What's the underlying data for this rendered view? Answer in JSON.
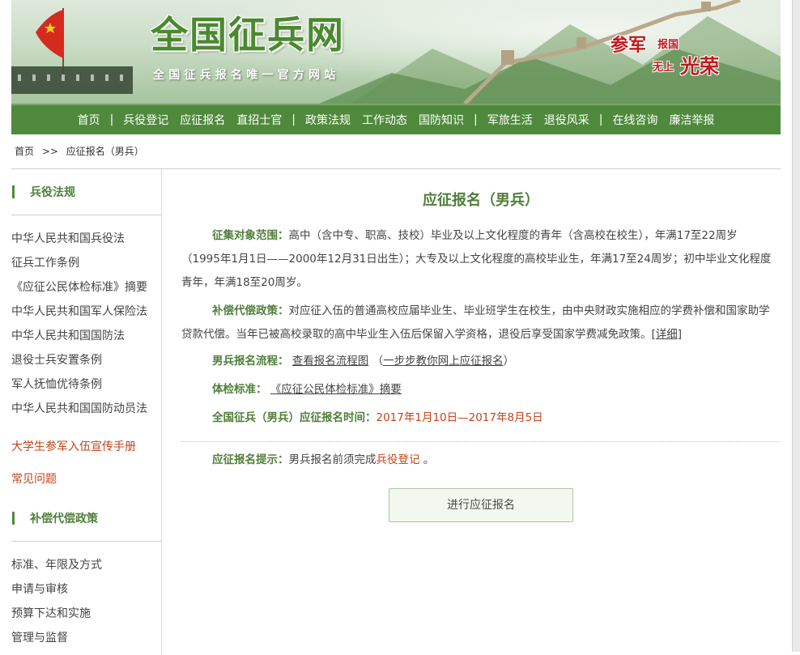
{
  "header": {
    "site_title": "全国征兵网",
    "site_subtitle": "全国征兵报名唯一官方网站",
    "slogan": {
      "part1": "参军",
      "part2": "报国",
      "part3": "无上",
      "part4": "光荣"
    }
  },
  "nav": {
    "items": [
      "首页",
      "兵役登记",
      "应征报名",
      "直招士官",
      "政策法规",
      "工作动态",
      "国防知识",
      "军旅生活",
      "退役风采",
      "在线咨询",
      "廉洁举报"
    ],
    "separator": "|"
  },
  "breadcrumb": {
    "home": "首页",
    "sep": ">>",
    "current": "应征报名（男兵）"
  },
  "sidebar": {
    "section1": {
      "title": "兵役法规",
      "items": [
        "中华人民共和国兵役法",
        "征兵工作条例",
        "《应征公民体检标准》摘要",
        "中华人民共和国军人保险法",
        "中华人民共和国国防法",
        "退役士兵安置条例",
        "军人抚恤优待条例",
        "中华人民共和国国防动员法"
      ]
    },
    "highlight1": "大学生参军入伍宣传手册",
    "highlight2": "常见问题",
    "section2": {
      "title": "补偿代偿政策",
      "items": [
        "标准、年限及方式",
        "申请与审核",
        "预算下达和实施",
        "管理与监督"
      ]
    }
  },
  "main": {
    "title": "应征报名（男兵）",
    "scope": {
      "label": "征集对象范围：",
      "text": "高中（含中专、职高、技校）毕业及以上文化程度的青年（含高校在校生），年满17至22周岁（1995年1月1日——2000年12月31日出生）；大专及以上文化程度的高校毕业生，年满17至24周岁；初中毕业文化程度青年，年满18至20周岁。"
    },
    "compensation": {
      "label": "补偿代偿政策：",
      "text": "对应征入伍的普通高校应届毕业生、毕业班学生在校生，由中央财政实施相应的学费补偿和国家助学贷款代偿。当年已被高校录取的高中毕业生入伍后保留入学资格，退役后享受国家学费减免政策。",
      "link": "[详细]"
    },
    "process": {
      "label": "男兵报名流程：",
      "link1": "查看报名流程图",
      "paren_open": "（",
      "link2": "一步步教你网上应征报名",
      "paren_close": "）"
    },
    "physical": {
      "label": "体检标准：",
      "link": "《应征公民体检标准》摘要"
    },
    "time": {
      "label": "全国征兵（男兵）应征报名时间：",
      "value": "2017年1月10日—2017年8月5日"
    },
    "tip": {
      "label": "应征报名提示：",
      "text": "男兵报名前须完成",
      "link": "兵役登记",
      "end": "。"
    },
    "button": "进行应征报名"
  },
  "colors": {
    "primary_green": "#4f8a3c",
    "accent_red": "#c4431b"
  }
}
